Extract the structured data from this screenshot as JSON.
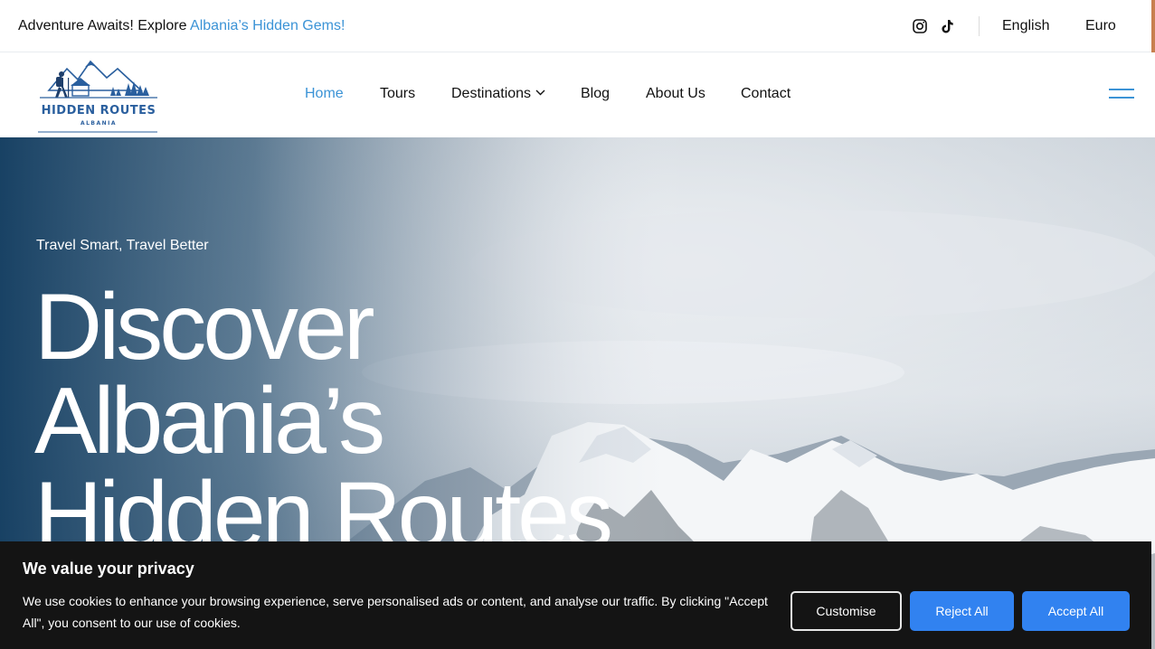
{
  "topbar": {
    "promo_prefix": "Adventure Awaits! Explore ",
    "promo_highlight": "Albania’s Hidden Gems!",
    "language": "English",
    "currency": "Euro",
    "social_icons": [
      "instagram-icon",
      "tiktok-icon"
    ]
  },
  "logo": {
    "wordmark": "HIDDEN ROUTES",
    "subtitle": "ALBANIA"
  },
  "nav": {
    "items": [
      {
        "label": "Home",
        "active": true
      },
      {
        "label": "Tours"
      },
      {
        "label": "Destinations",
        "has_dropdown": true
      },
      {
        "label": "Blog"
      },
      {
        "label": "About Us"
      },
      {
        "label": "Contact"
      }
    ],
    "menu_icon": "hamburger-menu-icon"
  },
  "hero": {
    "kicker": "Travel Smart, Travel Better",
    "headline_lines": [
      "Discover",
      "Albania’s",
      "Hidden Routes"
    ]
  },
  "cookie_banner": {
    "title": "We value your privacy",
    "text": "We use cookies to enhance your browsing experience, serve personalised ads or content, and analyse our traffic. By clicking \"Accept All\", you consent to our use of cookies.",
    "customise_label": "Customise",
    "reject_label": "Reject All",
    "accept_label": "Accept All"
  },
  "colors": {
    "accent": "#3b93d6",
    "logo_blue": "#2a5f9e",
    "cookie_bg": "#141414",
    "button_blue": "#3182f0",
    "hero_overlay": "#0f3a5e"
  }
}
